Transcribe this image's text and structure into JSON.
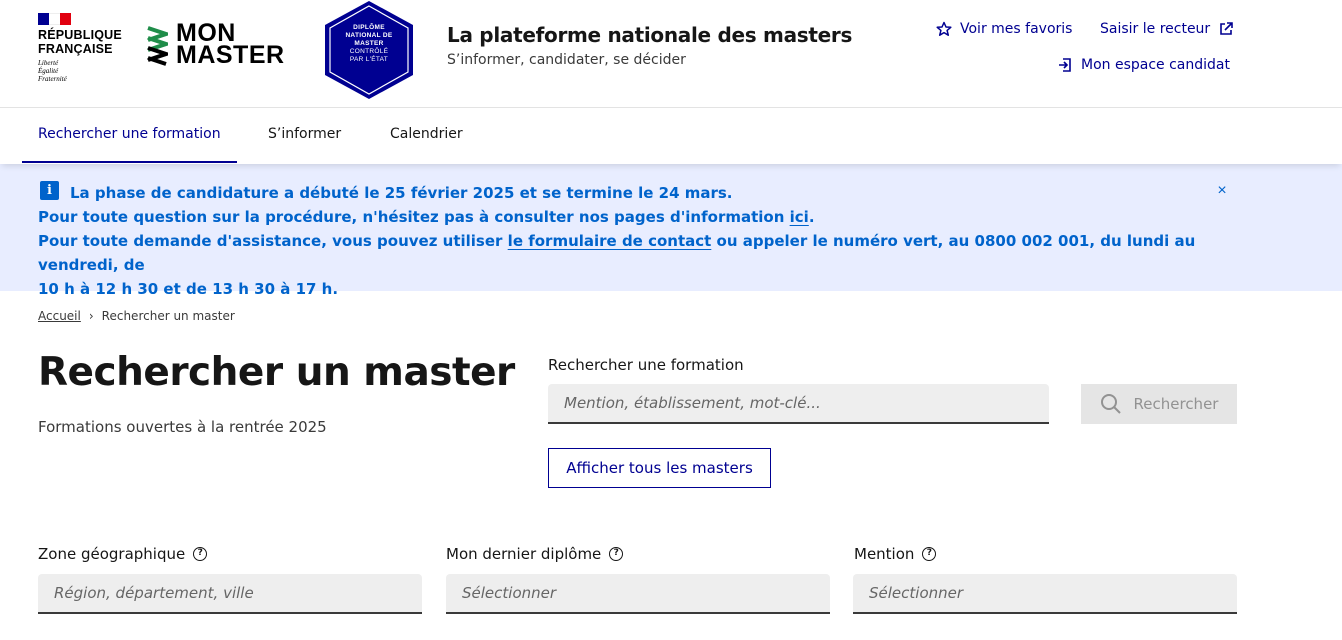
{
  "header": {
    "republic": {
      "line1": "RÉPUBLIQUE",
      "line2": "FRANÇAISE",
      "motto1": "Liberté",
      "motto2": "Égalité",
      "motto3": "Fraternité"
    },
    "brand": {
      "line1": "MON",
      "line2": "MASTER"
    },
    "badge": {
      "line1": "DIPLÔME",
      "line2": "NATIONAL DE",
      "line3": "MASTER",
      "line4": "CONTRÔLÉ",
      "line5": "PAR L'ÉTAT"
    },
    "site_title": "La plateforme nationale des masters",
    "site_tagline": "S’informer, candidater, se décider",
    "tools": {
      "favorites": "Voir mes favoris",
      "rector": "Saisir le recteur",
      "account": "Mon espace candidat"
    }
  },
  "nav": {
    "items": [
      {
        "label": "Rechercher une formation"
      },
      {
        "label": "S’informer"
      },
      {
        "label": "Calendrier"
      }
    ]
  },
  "notice": {
    "line1": "La phase de candidature a débuté le 25 février 2025 et se termine le 24 mars.",
    "line2_prefix": "Pour toute question sur la procédure, n'hésitez pas à consulter nos pages d'information ",
    "line2_link": "ici",
    "line2_suffix": ".",
    "line3_prefix": "Pour toute demande d'assistance, vous pouvez utiliser ",
    "line3_link": "le formulaire de contact",
    "line3_suffix": " ou appeler le numéro vert, au 0800 002 001, du lundi au vendredi, de",
    "line4": "10 h à 12 h 30 et de 13 h 30 à 17 h.",
    "close": "×"
  },
  "breadcrumb": {
    "home": "Accueil",
    "separator": "›",
    "current": "Rechercher un master"
  },
  "main": {
    "title": "Rechercher un master",
    "subtitle": "Formations ouvertes à la rentrée 2025",
    "search": {
      "label": "Rechercher une formation",
      "placeholder": "Mention, établissement, mot-clé...",
      "button": "Rechercher"
    },
    "all_button": "Afficher tous les masters"
  },
  "filters": [
    {
      "label": "Zone géographique",
      "placeholder": "Région, département, ville"
    },
    {
      "label": "Mon dernier diplôme",
      "placeholder": "Sélectionner"
    },
    {
      "label": "Mention",
      "placeholder": "Sélectionner"
    }
  ],
  "colors": {
    "primary": "#000091",
    "info": "#0063cb",
    "info_bg": "#e8edff",
    "brand_green": "#1f8d49",
    "flag_blue": "#000091",
    "flag_red": "#e1000f"
  }
}
